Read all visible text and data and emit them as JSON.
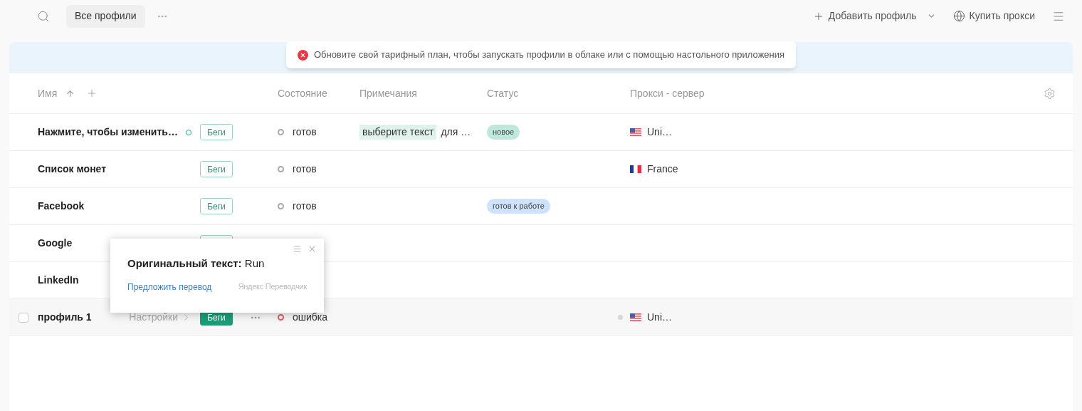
{
  "toolbar": {
    "view_tab": {
      "label": "Все профили",
      "selected": true
    },
    "add_profile": "Добавить профиль",
    "buy_proxy": "Купить прокси"
  },
  "banner": {
    "message": "Обновите свой тарифный план, чтобы запускать профили в облаке или с помощью настольного приложения"
  },
  "table": {
    "columns": [
      {
        "label": "Имя",
        "sorted": true
      },
      {
        "label": "Состояние"
      },
      {
        "label": "Примечания"
      },
      {
        "label": "Статус"
      },
      {
        "label": "Прокси - сервер"
      }
    ],
    "rows": [
      {
        "name": "Нажмите, чтобы изменить…",
        "name_dot": true,
        "run": {
          "label": "Беги"
        },
        "state": {
          "label": "готов",
          "color": "#a8a8a8"
        },
        "note": {
          "highlight": "выберите текст",
          "text": "для …"
        },
        "tag": {
          "label": "новое",
          "color": "#bfe8dc"
        },
        "proxy": {
          "kind": "us",
          "label": "Uni…"
        },
        "hovered": false
      },
      {
        "name": "Список монет",
        "name_dot": false,
        "run": {
          "label": "Беги"
        },
        "state": {
          "label": "готов",
          "color": "#a8a8a8"
        },
        "proxy": {
          "kind": "fr",
          "label": "France"
        },
        "hovered": false
      },
      {
        "name": "Facebook",
        "name_dot": false,
        "run": {
          "label": "Беги"
        },
        "state": {
          "label": "готов",
          "color": "#a8a8a8"
        },
        "tag": {
          "label": "готов к работе",
          "color": "#cfe2fb"
        },
        "hovered": false
      },
      {
        "name": "Google",
        "name_dot": false,
        "run": {},
        "hovered": false
      },
      {
        "name": "LinkedIn",
        "name_dot": false,
        "hovered": false
      },
      {
        "name": "профиль 1",
        "name_dot": false,
        "settings": "Настройки",
        "run": {
          "label": "Беги"
        },
        "state": {
          "label": "ошибка",
          "color": "#e05a5a"
        },
        "proxy": {
          "kind": "us",
          "label": "Uni…",
          "dot": true
        },
        "hovered": true
      }
    ]
  },
  "translate_popup": {
    "original": "**Оригинальный текст:** Run",
    "suggest_link": "Предложить перевод",
    "brand": "Яндекс Переводчик"
  }
}
